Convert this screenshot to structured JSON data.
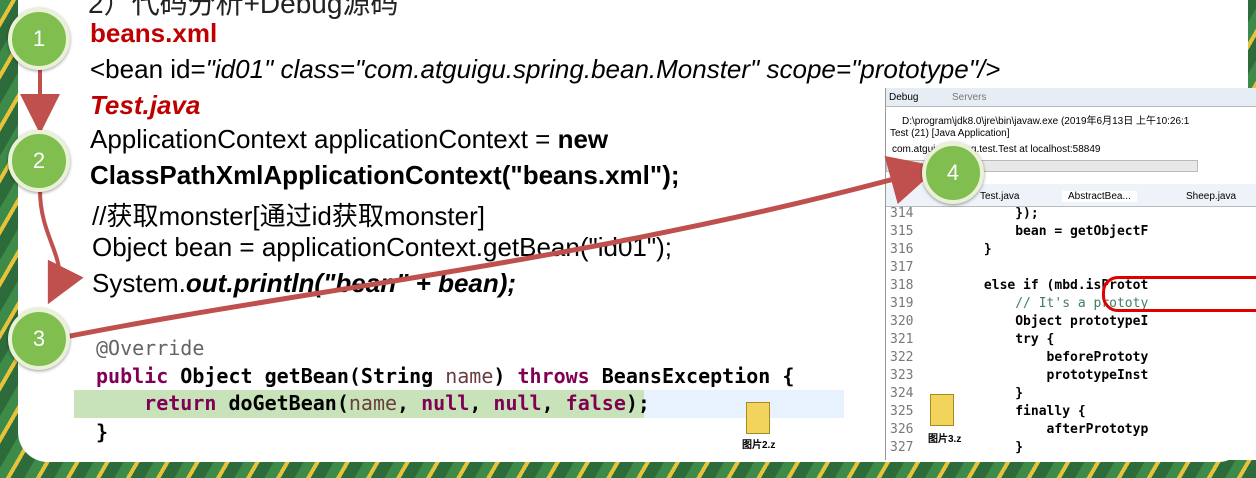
{
  "heading": "2）代码分析+Debug源码",
  "steps": [
    "1",
    "2",
    "3",
    "4"
  ],
  "xml": {
    "filename": "beans.xml",
    "bean_open": "<bean id=",
    "bean_attrs": "\"id01\" class=\"com.atguigu.spring.bean.Monster\" scope=\"prototype\"/>"
  },
  "java": {
    "filename": "Test.java",
    "line1_a": "ApplicationContext applicationContext = ",
    "line1_b": "new",
    "line2": "ClassPathXmlApplicationContext(\"beans.xml\");",
    "line3": "//获取monster[通过id获取monster]",
    "line4": "Object bean = applicationContext.getBean(\"id01\");",
    "line5_a": "System.",
    "line5_b": "out.println(\"bean\" + bean);"
  },
  "getbean_code": {
    "annotation": "@Override",
    "sig_kw": "public",
    "sig_a": " Object getBean(String ",
    "sig_param": "name",
    "sig_b": ") ",
    "sig_kw2": "throws",
    "sig_c": " BeansException {",
    "ret_kw": "return",
    "ret_a": " doGetBean(",
    "ret_param": "name",
    "ret_b": ", ",
    "ret_null1": "null",
    "ret_c": ", ",
    "ret_null2": "null",
    "ret_d": ", ",
    "ret_false": "false",
    "ret_e": ");",
    "close": "}"
  },
  "files": {
    "left_icon_label": "图片2.z",
    "right_icon_label": "图片3.z"
  },
  "eclipse": {
    "tab_debug": "Debug",
    "tab_servers": "Servers",
    "javaw_path": "D:\\program\\jdk8.0\\jre\\bin\\javaw.exe (2019年6月13日 上午10:26:1",
    "test_app": "Test (21) [Java Application]",
    "thread": "com.atguigu.spring.test.Test at localhost:58849",
    "editor_tab_1": "Test.java",
    "editor_tab_2": "AbstractBea...",
    "editor_tab_3": "Sheep.java",
    "code_lines": [
      {
        "n": "314",
        "t": "            });"
      },
      {
        "n": "315",
        "t": "            bean = getObjectF"
      },
      {
        "n": "316",
        "t": "        }"
      },
      {
        "n": "317",
        "t": ""
      },
      {
        "n": "318",
        "t": "        else if (mbd.isProtot"
      },
      {
        "n": "319",
        "t": "            // It's a prototy"
      },
      {
        "n": "320",
        "t": "            Object prototypeI"
      },
      {
        "n": "321",
        "t": "            try {"
      },
      {
        "n": "322",
        "t": "                beforePrototy"
      },
      {
        "n": "323",
        "t": "                prototypeInst"
      },
      {
        "n": "324",
        "t": "            }"
      },
      {
        "n": "325",
        "t": "            finally {"
      },
      {
        "n": "326",
        "t": "                afterPrototyp"
      },
      {
        "n": "327",
        "t": "            }"
      }
    ]
  }
}
